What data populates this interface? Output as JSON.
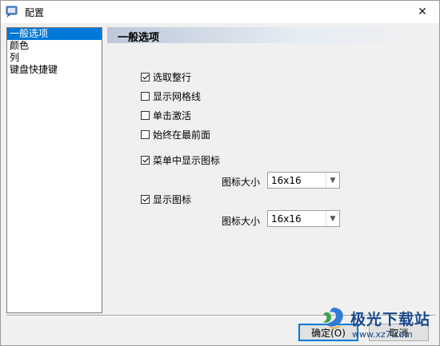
{
  "window": {
    "title": "配置"
  },
  "nav": {
    "items": [
      {
        "label": "一般选项",
        "selected": true
      },
      {
        "label": "颜色"
      },
      {
        "label": "列"
      },
      {
        "label": "键盘快捷键"
      }
    ]
  },
  "section": {
    "title": "一般选项"
  },
  "options": {
    "select_row": {
      "label": "选取整行",
      "checked": true
    },
    "show_grid": {
      "label": "显示网格线",
      "checked": false
    },
    "single_click": {
      "label": "单击激活",
      "checked": false
    },
    "always_on_top": {
      "label": "始终在最前面",
      "checked": false
    },
    "menu_icons": {
      "label": "菜单中显示图标",
      "checked": true
    },
    "menu_icon_size": {
      "label": "图标大小",
      "value": "16x16"
    },
    "show_icons": {
      "label": "显示图标",
      "checked": true
    },
    "icon_size": {
      "label": "图标大小",
      "value": "16x16"
    }
  },
  "buttons": {
    "ok": "确定(O)",
    "cancel": "取消"
  },
  "watermark": {
    "text": "极光下载站",
    "url": "www.xz7.com"
  },
  "colors": {
    "selection": "#0078d7",
    "header_gradient_start": "#bcc8d8"
  }
}
